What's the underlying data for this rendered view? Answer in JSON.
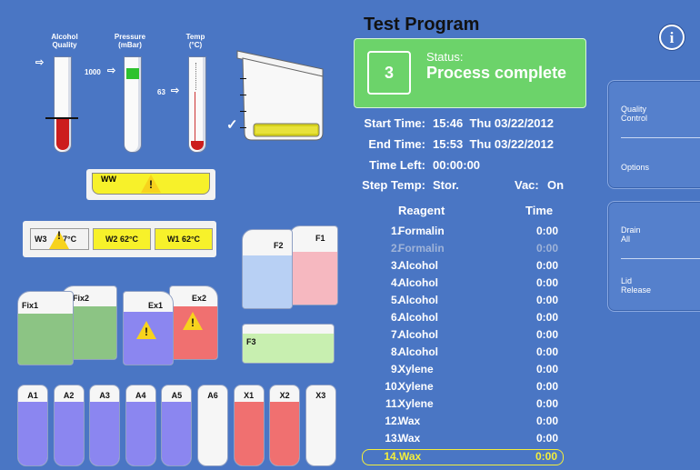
{
  "gauges": {
    "alcohol_label": "Alcohol\nQuality",
    "pressure_label": "Pressure\n(mBar)",
    "temp_label": "Temp\n(°C)",
    "pressure_value": "1000",
    "temp_value": "63"
  },
  "program": {
    "title": "Test Program",
    "step_number": "3",
    "status_label": "Status:",
    "status_text": "Process complete",
    "start_label": "Start Time:",
    "start_value": "15:46  Thu 03/22/2012",
    "end_label": "End Time:",
    "end_value": "15:53  Thu 03/22/2012",
    "left_label": "Time Left:",
    "left_value": "00:00:00",
    "step_temp_label": "Step Temp:",
    "step_temp_value": "Stor.",
    "vac_label": "Vac:",
    "vac_value": "On",
    "reagent_header": "Reagent",
    "time_header": "Time"
  },
  "steps": [
    {
      "num": "1.",
      "name": "Formalin",
      "time": "0:00"
    },
    {
      "num": "2.",
      "name": "Formalin",
      "time": "0:00"
    },
    {
      "num": "3.",
      "name": "Alcohol",
      "time": "0:00"
    },
    {
      "num": "4.",
      "name": "Alcohol",
      "time": "0:00"
    },
    {
      "num": "5.",
      "name": "Alcohol",
      "time": "0:00"
    },
    {
      "num": "6.",
      "name": "Alcohol",
      "time": "0:00"
    },
    {
      "num": "7.",
      "name": "Alcohol",
      "time": "0:00"
    },
    {
      "num": "8.",
      "name": "Alcohol",
      "time": "0:00"
    },
    {
      "num": "9.",
      "name": "Xylene",
      "time": "0:00"
    },
    {
      "num": "10.",
      "name": "Xylene",
      "time": "0:00"
    },
    {
      "num": "11.",
      "name": "Xylene",
      "time": "0:00"
    },
    {
      "num": "12.",
      "name": "Wax",
      "time": "0:00"
    },
    {
      "num": "13.",
      "name": "Wax",
      "time": "0:00"
    },
    {
      "num": "14.",
      "name": "Wax",
      "time": "0:00"
    }
  ],
  "side": {
    "quality_control": "Quality\nControl",
    "options": "Options",
    "drain_all": "Drain\nAll",
    "lid_release": "Lid\nRelease"
  },
  "icons": {
    "info": "i",
    "warning": "!",
    "check": "✓"
  },
  "containers": {
    "ww": "WW",
    "w3": "W3",
    "w3_temp": "37°C",
    "w2": "W2  62°C",
    "w1": "W1  62°C",
    "f1": "F1",
    "f2": "F2",
    "f3": "F3",
    "fix1": "Fix1",
    "fix2": "Fix2",
    "ex1": "Ex1",
    "ex2": "Ex2",
    "a1": "A1",
    "a2": "A2",
    "a3": "A3",
    "a4": "A4",
    "a5": "A5",
    "a6": "A6",
    "x1": "X1",
    "x2": "X2",
    "x3": "X3"
  },
  "colors": {
    "status_green": "#6cd36a",
    "wax_yellow": "#f7f12a",
    "alcohol_violet": "#8b86f0",
    "xylene_red": "#f07070",
    "formalin_pink": "#f6b8c0",
    "f2_blue": "#b8d0f4",
    "fix_green": "#8cc484",
    "f3_green": "#c8efb0"
  }
}
